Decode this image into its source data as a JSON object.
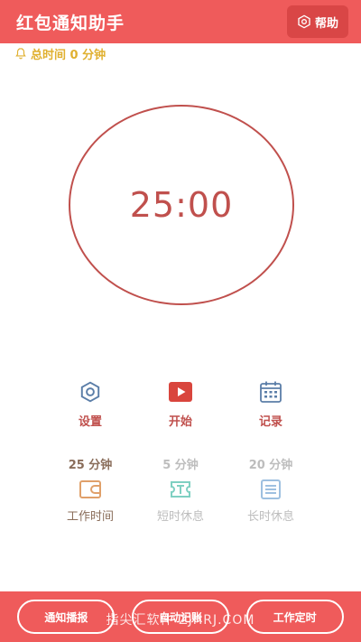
{
  "app_bar": {
    "title": "红包通知助手",
    "help_label": "帮助"
  },
  "total_time": {
    "label": "总时间 0 分钟"
  },
  "timer": {
    "display": "25:00"
  },
  "actions": [
    {
      "label": "设置",
      "icon": "gear-icon"
    },
    {
      "label": "开始",
      "icon": "play-icon"
    },
    {
      "label": "记录",
      "icon": "calendar-icon"
    }
  ],
  "modes": [
    {
      "duration": "25 分钟",
      "label": "工作时间",
      "icon": "work-card-icon",
      "active": true
    },
    {
      "duration": "5 分钟",
      "label": "短时休息",
      "icon": "short-break-icon",
      "active": false
    },
    {
      "duration": "20 分钟",
      "label": "长时休息",
      "icon": "long-break-icon",
      "active": false
    }
  ],
  "bottom_bar": {
    "buttons": [
      {
        "label": "通知播报"
      },
      {
        "label": "自动记账"
      },
      {
        "label": "工作定时"
      }
    ],
    "watermark": "指尖汇软件 ZJHRJ.COM"
  },
  "colors": {
    "primary_red": "#ef5b5b",
    "accent_dark_red": "#c0504d",
    "gold": "#e0b030",
    "teal": "#3bb3a0",
    "blue_gray": "#5b7ea8",
    "inactive": "#bdbdbd"
  }
}
